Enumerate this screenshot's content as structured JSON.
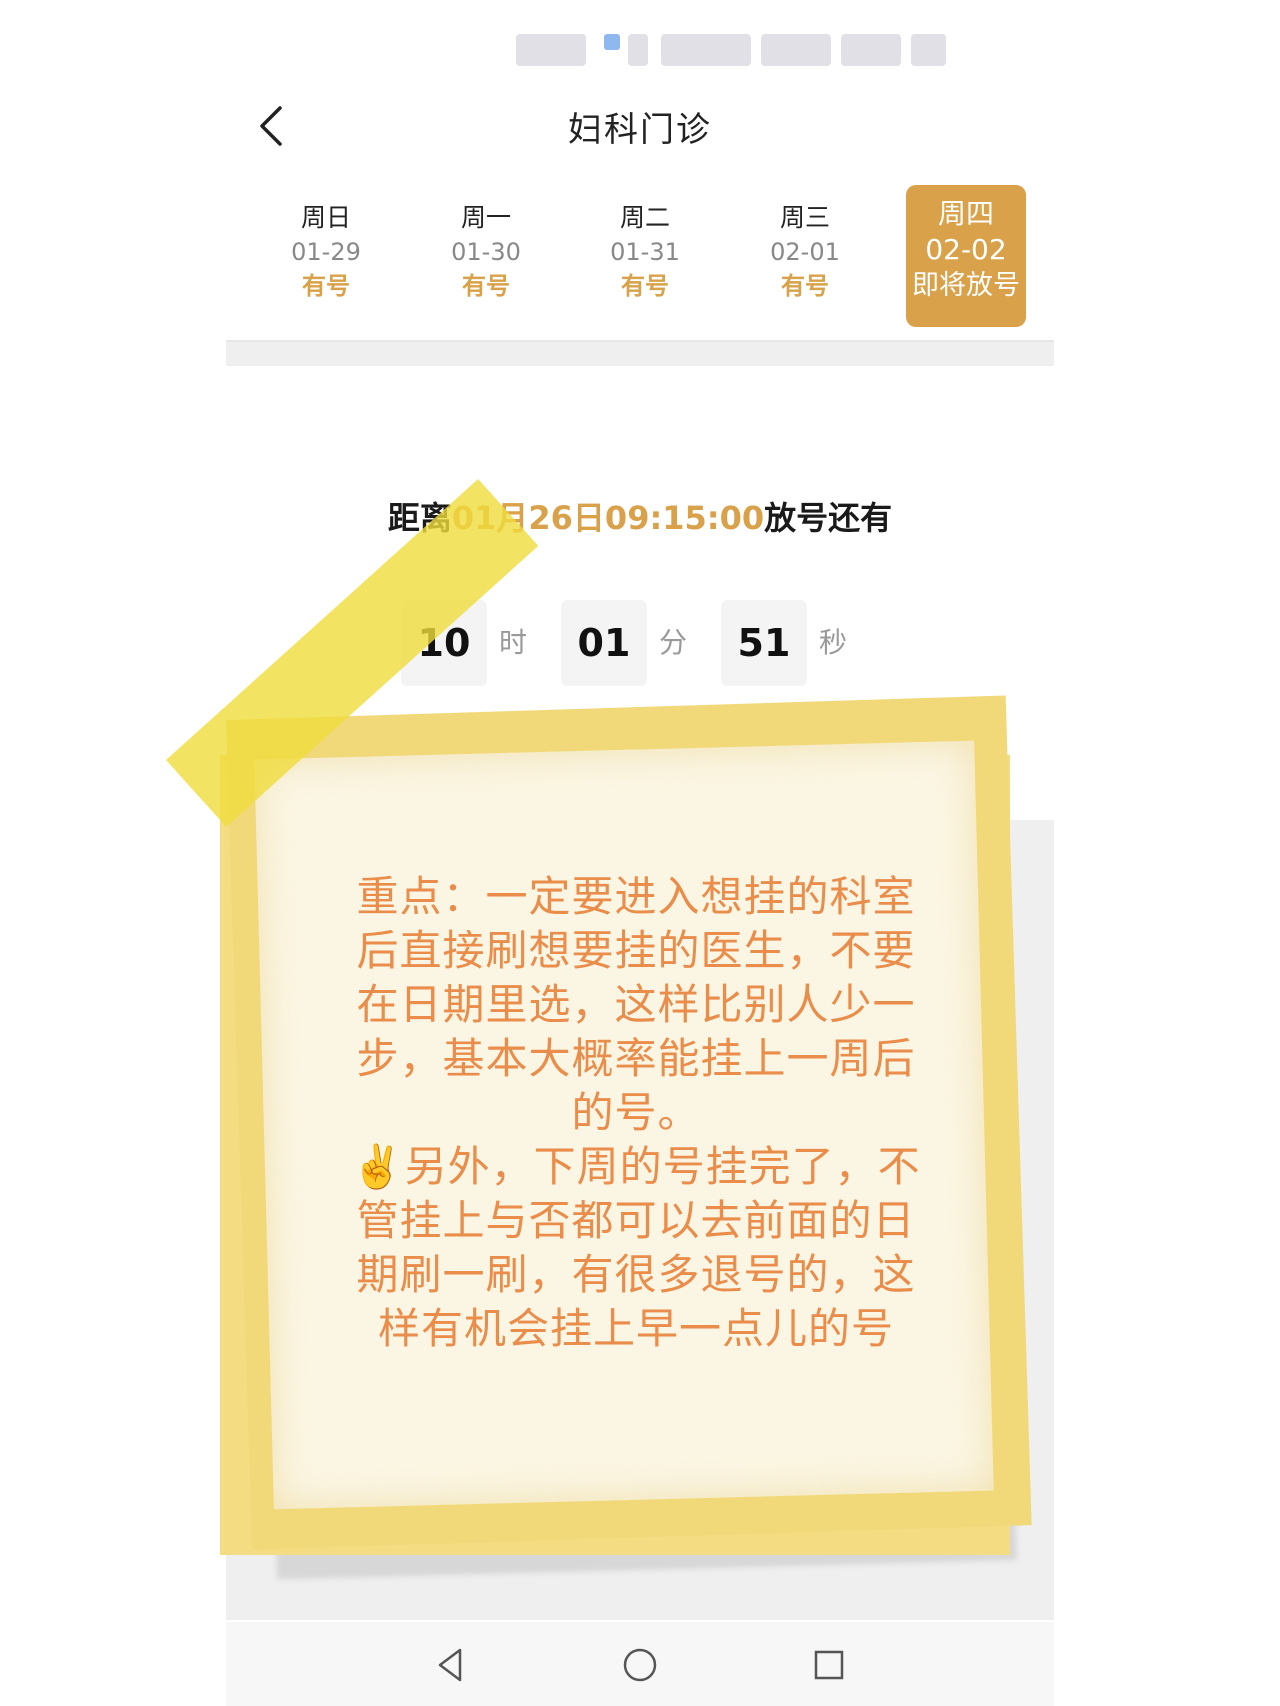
{
  "header": {
    "title": "妇科门诊"
  },
  "days": [
    {
      "weekday": "周日",
      "date": "01-29",
      "status": "有号",
      "active": false
    },
    {
      "weekday": "周一",
      "date": "01-30",
      "status": "有号",
      "active": false
    },
    {
      "weekday": "周二",
      "date": "01-31",
      "status": "有号",
      "active": false
    },
    {
      "weekday": "周三",
      "date": "02-01",
      "status": "有号",
      "active": false
    },
    {
      "weekday": "周四",
      "date": "02-02",
      "status": "即将放号",
      "active": true
    }
  ],
  "countdown": {
    "prefix": "距离",
    "release_time": "01月26日09:15:00",
    "suffix": "放号还有",
    "hours": "10",
    "hours_unit": "时",
    "minutes": "01",
    "minutes_unit": "分",
    "seconds": "51",
    "seconds_unit": "秒"
  },
  "note": {
    "paragraph1": "重点：一定要进入想挂的科室后直接刷想要挂的医生，不要在日期里选，这样比别人少一步，基本大概率能挂上一周后的号。",
    "paragraph2": "✌️另外，下周的号挂完了，不管挂上与否都可以去前面的日期刷一刷，有很多退号的，这样有机会挂上早一点儿的号"
  },
  "colors": {
    "accent": "#d9a24a",
    "note_text": "#ea8c4a",
    "sticky": "#f1d97a",
    "tape": "#f0dc3c"
  },
  "icons": {
    "back": "chevron-left-icon",
    "nav_back": "triangle-back-icon",
    "nav_home": "circle-home-icon",
    "nav_recents": "square-recents-icon"
  }
}
